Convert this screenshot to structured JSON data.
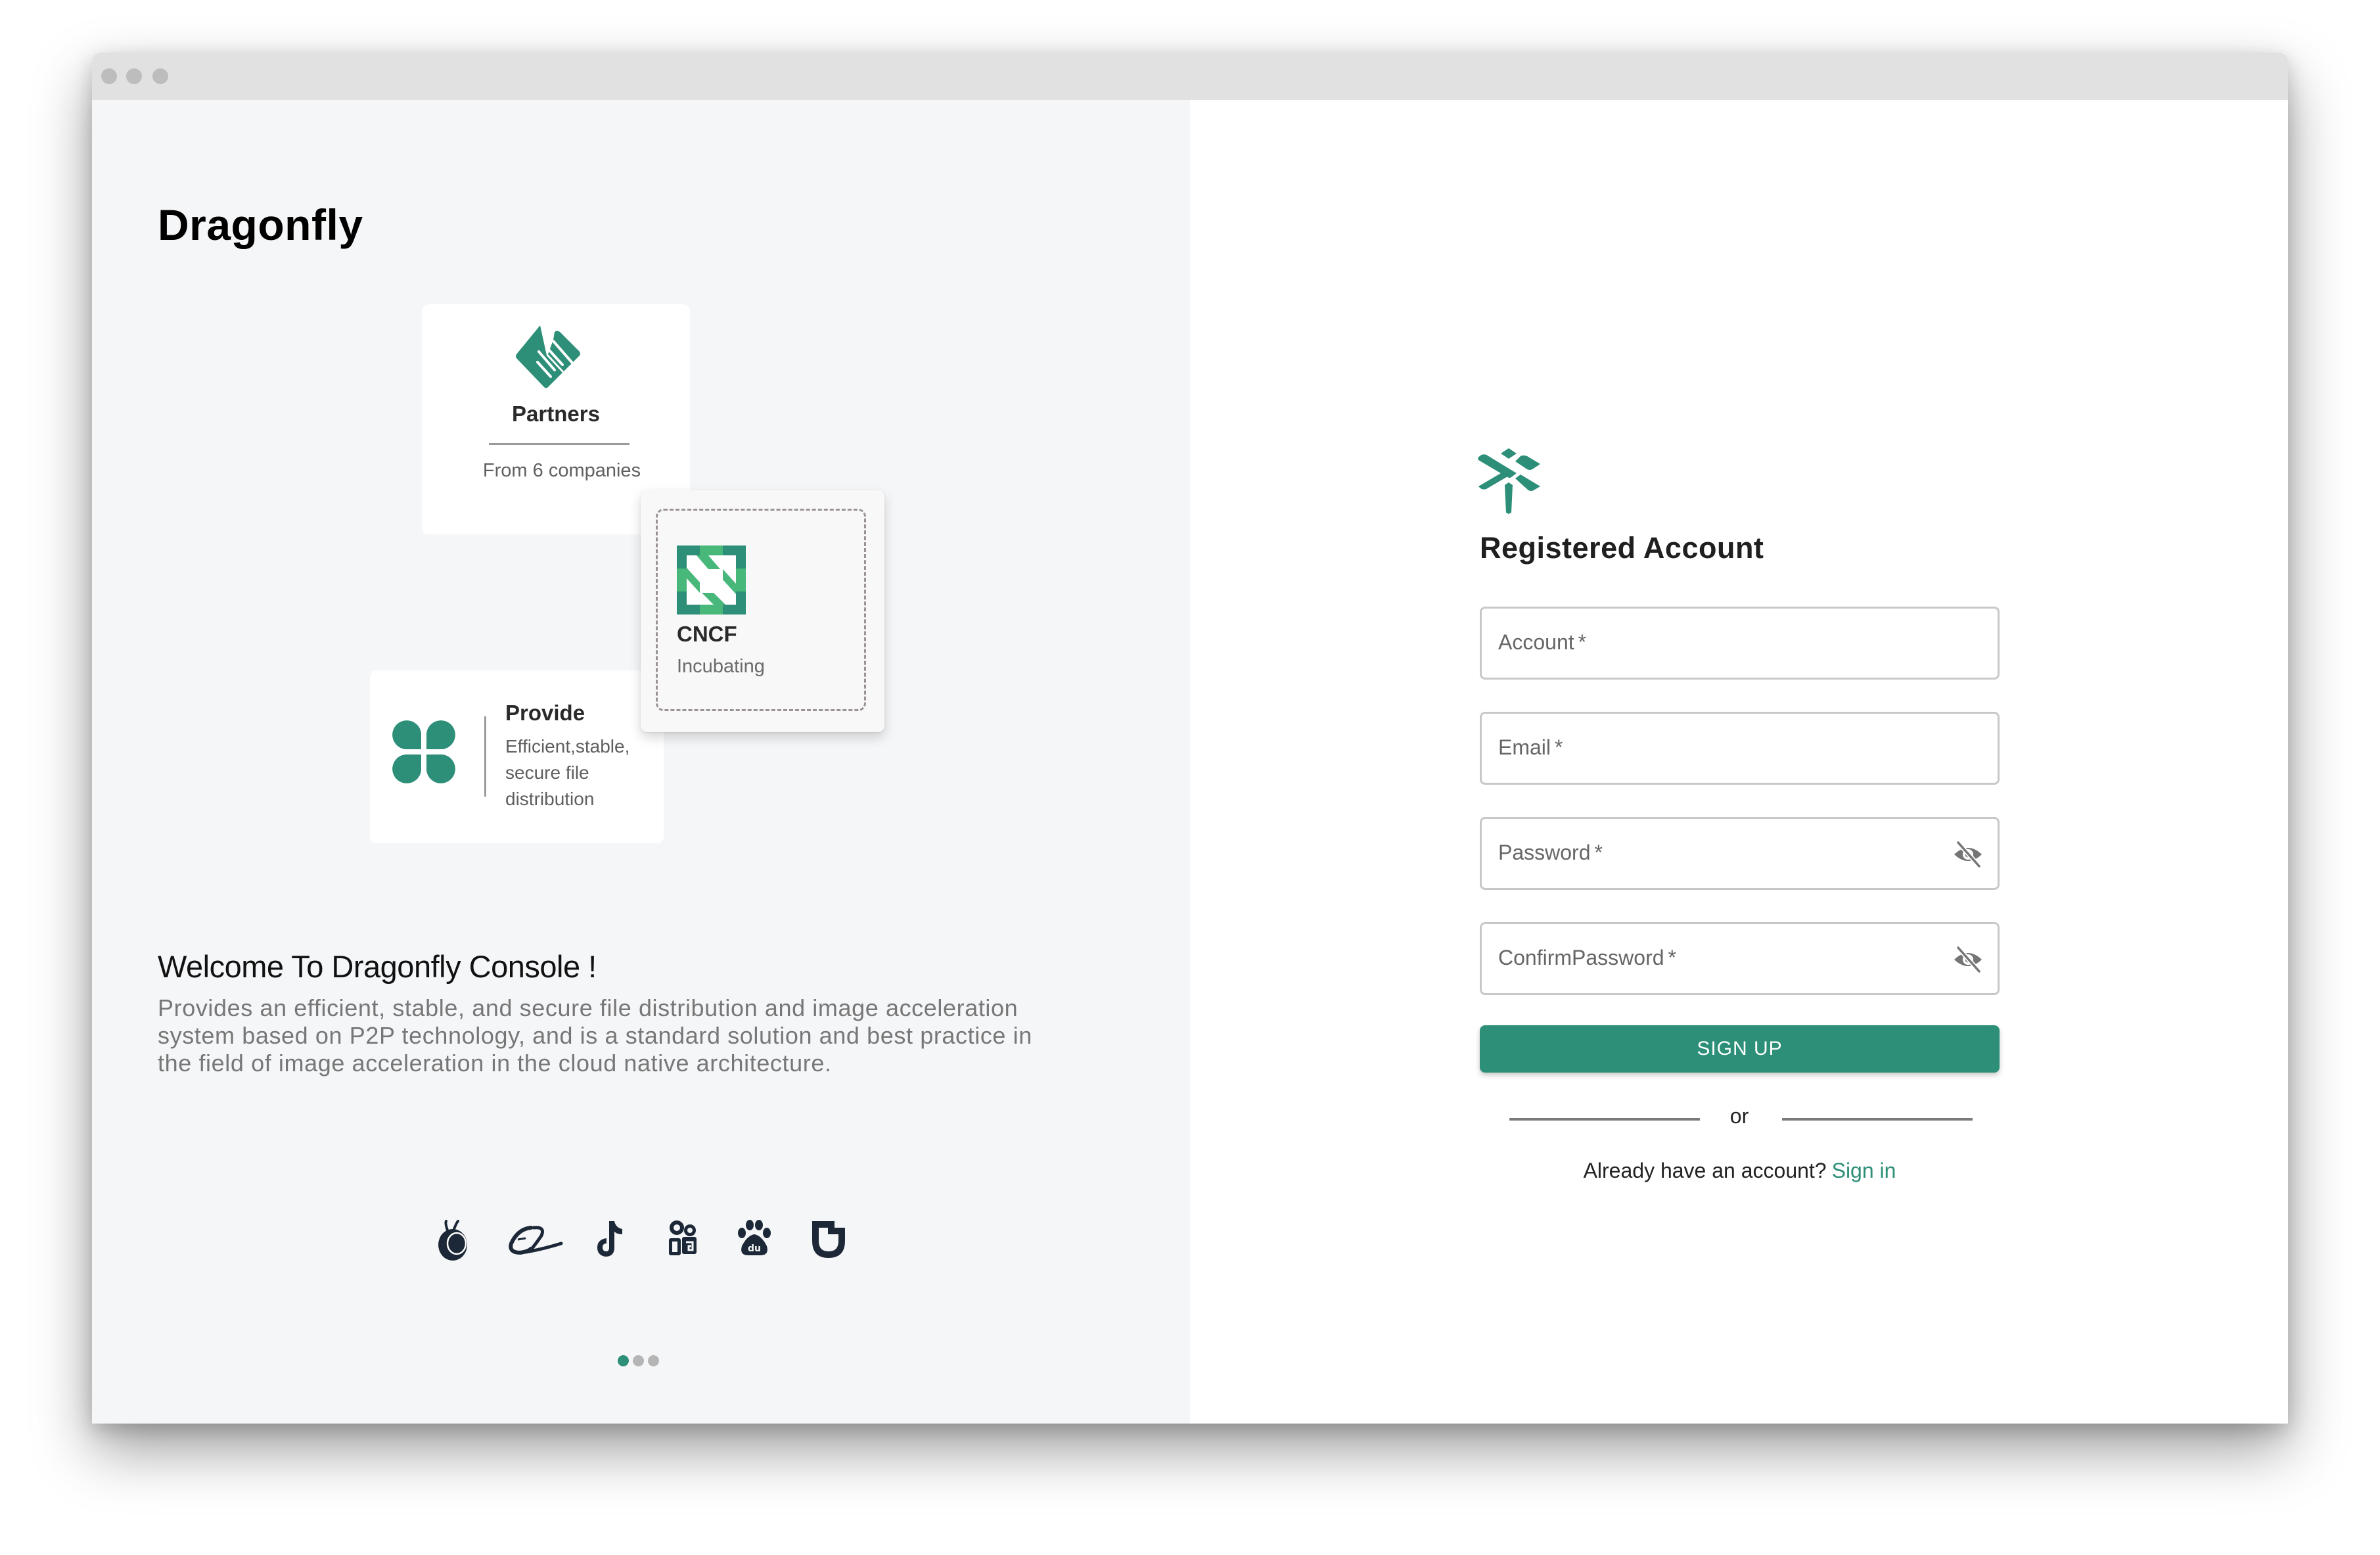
{
  "window": {
    "traffic_lights": [
      "close",
      "minimize",
      "maximize"
    ]
  },
  "left": {
    "brand_title": "Dragonfly",
    "partners_card": {
      "icon": "handshake-icon",
      "title": "Partners",
      "subtitle": "From 6 companies"
    },
    "cncf_card": {
      "icon": "cncf-logo-icon",
      "title": "CNCF",
      "subtitle": "Incubating"
    },
    "provide_card": {
      "icon": "clover-icon",
      "title": "Provide",
      "description": "Efficient,stable, secure file distribution"
    },
    "welcome_title": "Welcome To Dragonfly Console !",
    "welcome_description": "Provides an efficient, stable, and secure file distribution and image acceleration system based on P2P technology, and is a standard solution and best practice in the field of image acceleration in the cloud native architecture.",
    "partner_logos": [
      "ant-group-icon",
      "alibaba-icon",
      "tiktok-icon",
      "kuaishou-icon",
      "baidu-icon",
      "didi-icon"
    ],
    "carousel": {
      "count": 3,
      "active_index": 0
    }
  },
  "right": {
    "logo": "dragonfly-logo-icon",
    "title": "Registered Account",
    "fields": [
      {
        "label": "Account",
        "required_mark": "*",
        "value": "",
        "type": "text"
      },
      {
        "label": "Email",
        "required_mark": "*",
        "value": "",
        "type": "email"
      },
      {
        "label": "Password",
        "required_mark": "*",
        "value": "",
        "type": "password",
        "toggle_icon": "eye-off-icon"
      },
      {
        "label": "ConfirmPassword",
        "required_mark": "*",
        "value": "",
        "type": "password",
        "toggle_icon": "eye-off-icon"
      }
    ],
    "signup_label": "SIGN UP",
    "divider_text": "or",
    "signin_prompt": "Already have an account?",
    "signin_link": "Sign in"
  },
  "colors": {
    "accent": "#2d8f78",
    "cncf_light": "#47b87a",
    "left_bg": "#f5f6f8",
    "brand_icons": "#1c2837"
  }
}
